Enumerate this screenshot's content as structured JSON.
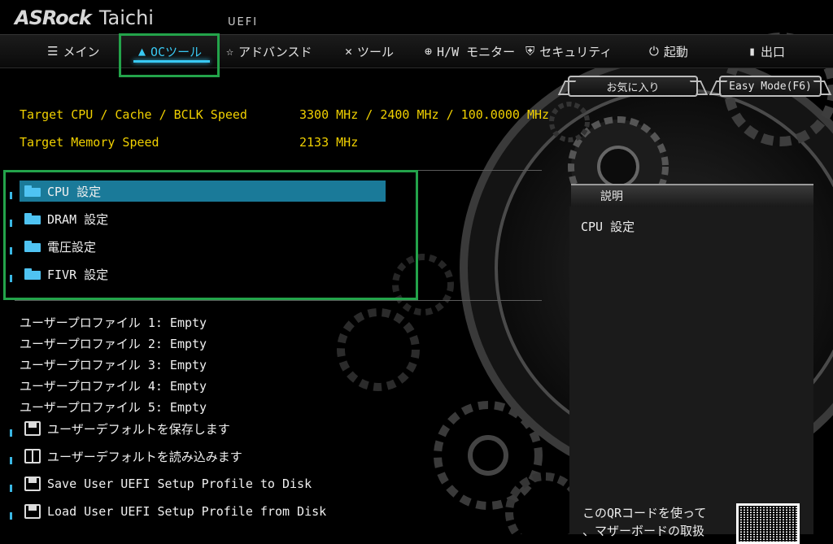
{
  "header": {
    "brand": "ASRock",
    "model": "Taichi",
    "firmware": "UEFI"
  },
  "tabs": [
    {
      "label": "メイン",
      "icon": "list-icon"
    },
    {
      "label": "OCツール",
      "icon": "rocket-icon",
      "active": true
    },
    {
      "label": "アドバンスド",
      "icon": "star-icon"
    },
    {
      "label": "ツール",
      "icon": "tools-icon"
    },
    {
      "label": "H/W モニター",
      "icon": "crosshair-icon"
    },
    {
      "label": "セキュリティ",
      "icon": "shield-icon"
    },
    {
      "label": "起動",
      "icon": "power-icon"
    },
    {
      "label": "出口",
      "icon": "exit-icon"
    }
  ],
  "buttons": {
    "favorites": "お気に入り",
    "easy_mode": "Easy Mode(F6)"
  },
  "info": {
    "cpu_label": "Target CPU / Cache / BCLK Speed",
    "cpu_value": "3300 MHz / 2400 MHz / 100.0000 MHz",
    "mem_label": "Target Memory Speed",
    "mem_value": "2133 MHz"
  },
  "menu": [
    {
      "label": "CPU 設定",
      "selected": true
    },
    {
      "label": "DRAM 設定"
    },
    {
      "label": "電圧設定"
    },
    {
      "label": "FIVR 設定"
    }
  ],
  "profiles": [
    "ユーザープロファイル 1: Empty",
    "ユーザープロファイル 2: Empty",
    "ユーザープロファイル 3: Empty",
    "ユーザープロファイル 4: Empty",
    "ユーザープロファイル 5: Empty"
  ],
  "actions": [
    {
      "label": "ユーザーデフォルトを保存します",
      "icon": "save-icon"
    },
    {
      "label": "ユーザーデフォルトを読み込みます",
      "icon": "book-icon"
    },
    {
      "label": "Save User UEFI Setup Profile to Disk",
      "icon": "disk-save-icon"
    },
    {
      "label": "Load User UEFI Setup Profile from Disk",
      "icon": "disk-load-icon"
    }
  ],
  "description": {
    "title": "説明",
    "text": "CPU 設定",
    "qr_line1": "このQRコードを使って",
    "qr_line2": "、マザーボードの取扱"
  },
  "colors": {
    "accent": "#39c9f3",
    "info_text": "#f0d000",
    "selection": "#1a7a99",
    "highlight_frame": "#23a34a"
  }
}
